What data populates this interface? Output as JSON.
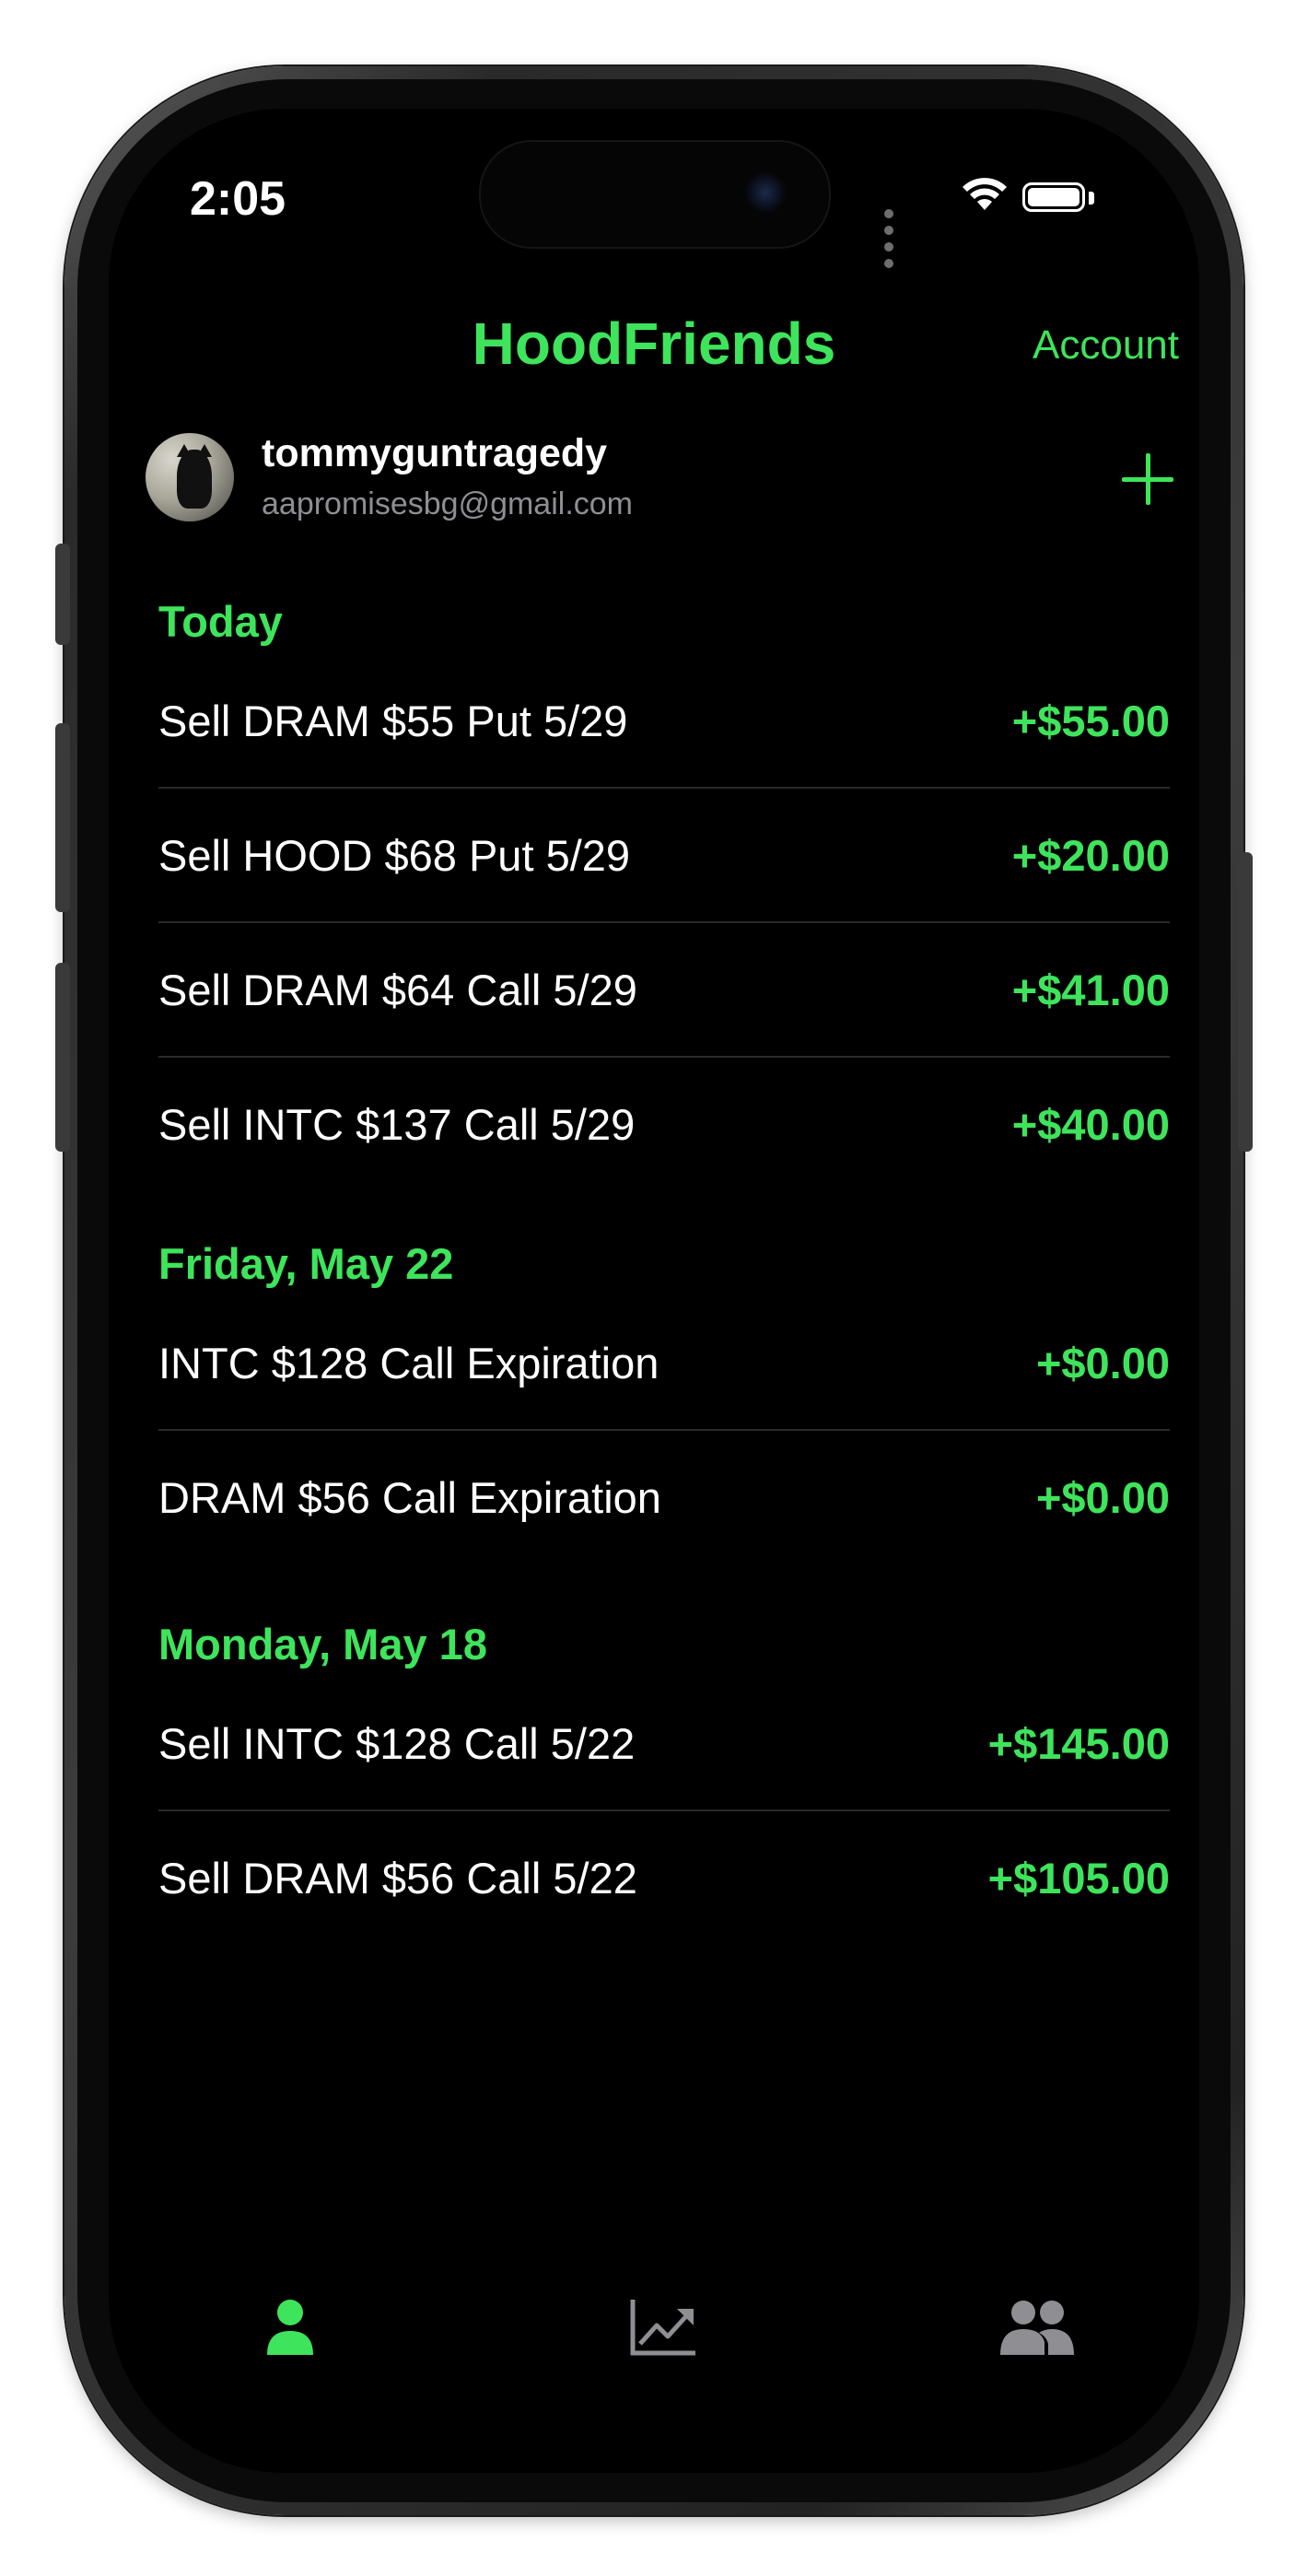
{
  "status_bar": {
    "time": "2:05"
  },
  "header": {
    "title": "HoodFriends",
    "account_label": "Account"
  },
  "profile": {
    "username": "tommyguntragedy",
    "email": "aapromisesbg@gmail.com",
    "add_icon": "plus-icon"
  },
  "sections": [
    {
      "title": "Today",
      "rows": [
        {
          "label": "Sell DRAM $55 Put 5/29",
          "amount": "+$55.00"
        },
        {
          "label": "Sell HOOD $68 Put 5/29",
          "amount": "+$20.00"
        },
        {
          "label": "Sell DRAM $64 Call 5/29",
          "amount": "+$41.00"
        },
        {
          "label": "Sell INTC $137 Call 5/29",
          "amount": "+$40.00"
        }
      ]
    },
    {
      "title": "Friday, May 22",
      "rows": [
        {
          "label": "INTC $128 Call Expiration",
          "amount": "+$0.00"
        },
        {
          "label": "DRAM $56 Call Expiration",
          "amount": "+$0.00"
        }
      ]
    },
    {
      "title": "Monday, May 18",
      "rows": [
        {
          "label": "Sell INTC $128 Call 5/22",
          "amount": "+$145.00"
        },
        {
          "label": "Sell DRAM $56 Call 5/22",
          "amount": "+$105.00"
        }
      ]
    }
  ],
  "tab_bar": [
    {
      "icon": "person-icon",
      "active": true
    },
    {
      "icon": "chart-icon",
      "active": false
    },
    {
      "icon": "friends-icon",
      "active": false
    }
  ],
  "colors": {
    "accent": "#3ee45b",
    "background": "#000000",
    "text": "#ffffff",
    "secondary_text": "#8e8e93",
    "inactive_icon": "#8e8e93"
  }
}
